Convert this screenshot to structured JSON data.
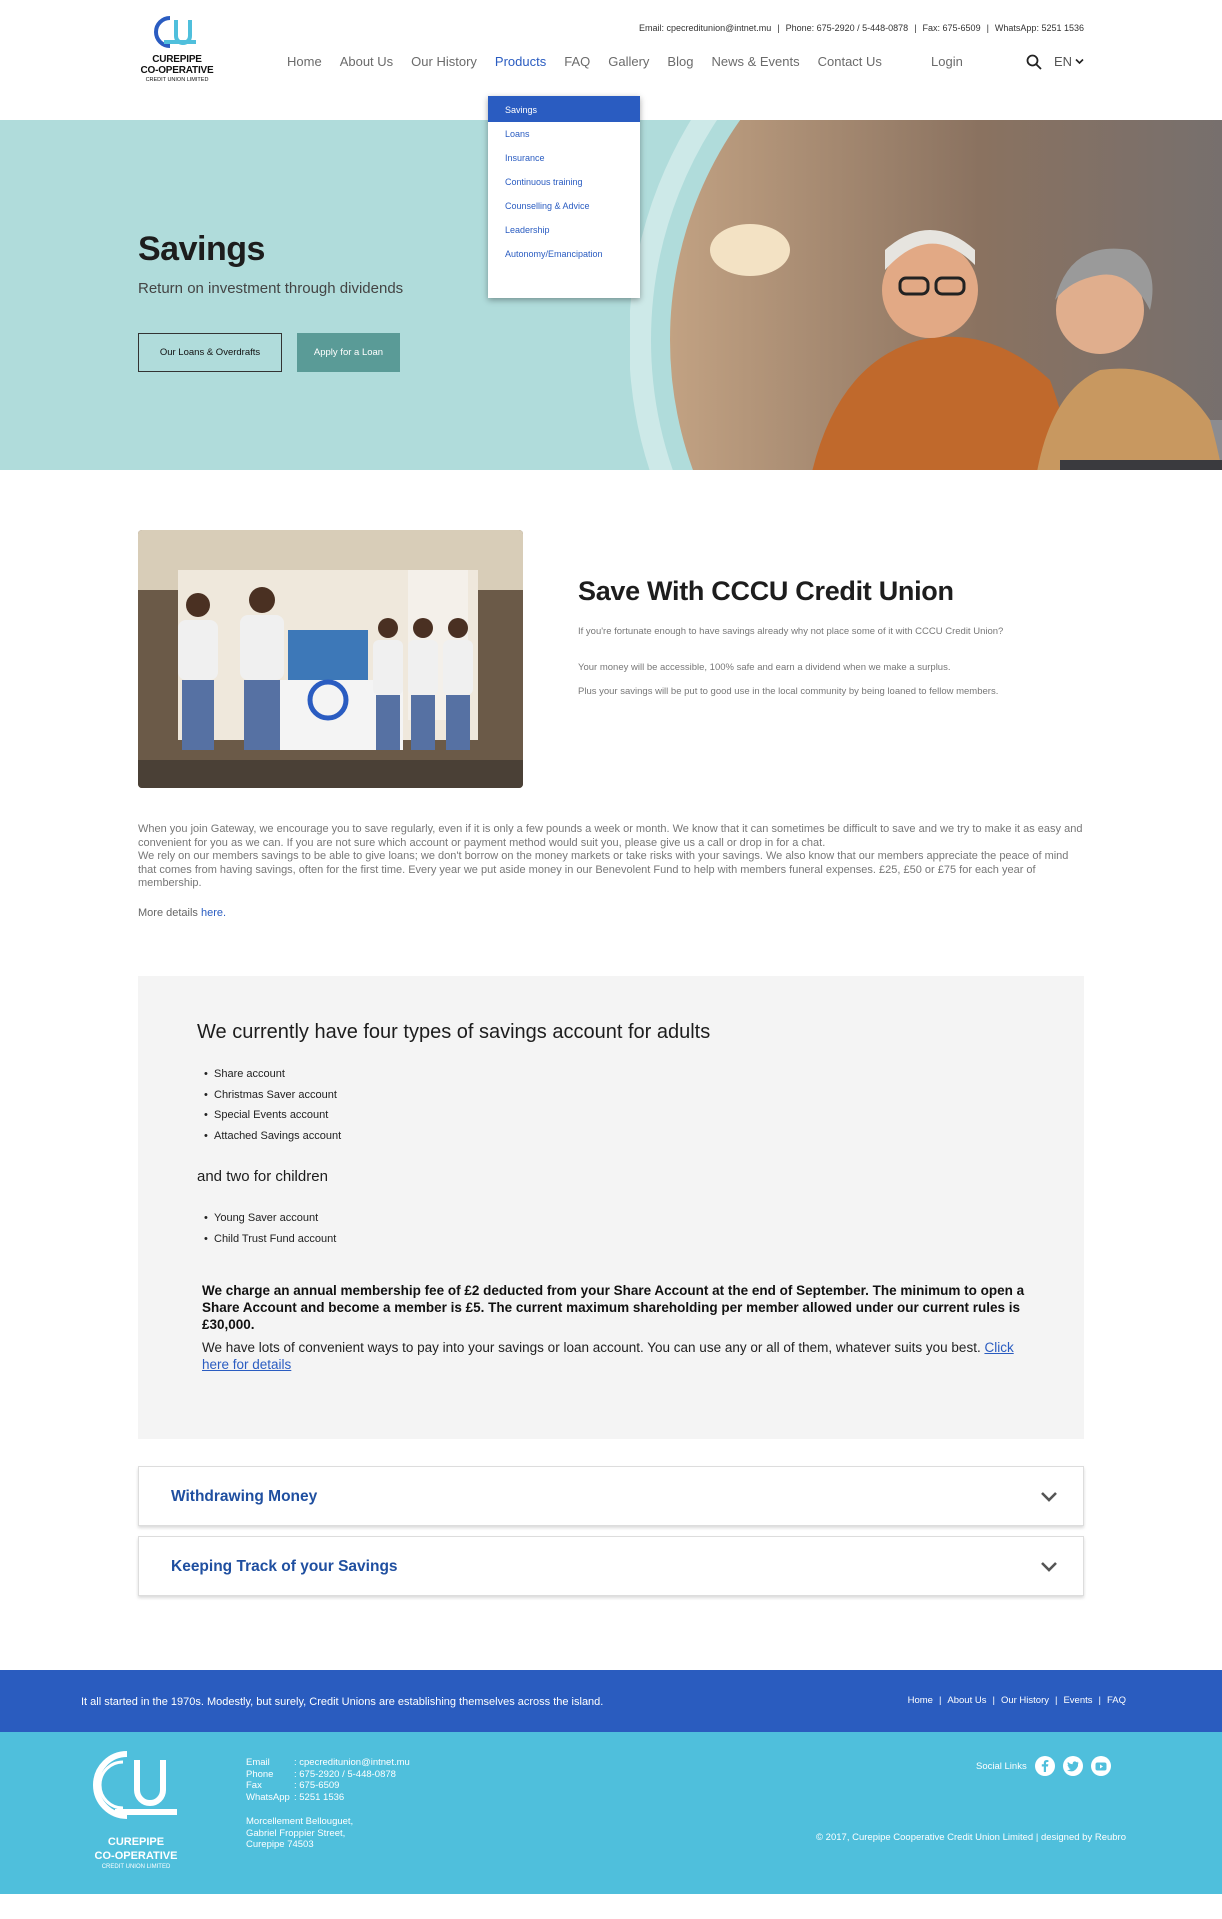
{
  "header": {
    "logo": {
      "line1": "CUREPIPE",
      "line2": "CO-OPERATIVE",
      "line3": "CREDIT UNION LIMITED"
    },
    "top_info": {
      "email": "Email: cpecreditunion@intnet.mu",
      "phone": "Phone: 675-2920 / 5-448-0878",
      "fax": "Fax: 675-6509",
      "whatsapp": "WhatsApp: 5251 1536"
    },
    "nav": [
      "Home",
      "About Us",
      "Our History",
      "Products",
      "FAQ",
      "Gallery",
      "Blog",
      "News & Events",
      "Contact Us"
    ],
    "login": "Login",
    "lang": "EN"
  },
  "dropdown": {
    "items": [
      "Savings",
      "Loans",
      "Insurance",
      "Continuous training",
      "Counselling & Advice",
      "Leadership",
      "Autonomy/Emancipation"
    ]
  },
  "hero": {
    "title": "Savings",
    "subtitle": "Return on investment through dividends",
    "btn_outline": "Our Loans & Overdrafts",
    "btn_fill": "Apply for a Loan"
  },
  "intro": {
    "title": "Save With CCCU Credit Union",
    "p1": "If you're fortunate enough to have savings already why not place some of it with CCCU Credit Union?",
    "p2": "Your money will be accessible, 100% safe and earn a dividend when we make a surplus.",
    "p3": "Plus your savings will be put to good use in the local community by being loaned to fellow members."
  },
  "body": {
    "p1": "When you join Gateway, we encourage you to save regularly, even if it is only a few pounds a week or month. We know that it can sometimes be difficult to save and we try to make it as easy and convenient for you as we can. If you are not sure which account or payment method would suit you, please give us a call or drop in for a chat.",
    "p2": "We rely on our members savings to be able to give loans; we don't borrow on the money markets or take risks with your savings. We also know that our members appreciate the peace of mind that comes from having savings, often for the first time. Every year we put aside money in our Benevolent Fund to help with members funeral expenses. £25, £50 or £75 for each year of membership.",
    "more_prefix": "More details ",
    "more_link": "here."
  },
  "panel": {
    "title": "We currently have four types of savings account for adults",
    "adult_accounts": [
      "Share account",
      "Christmas Saver account",
      "Special Events account",
      "Attached Savings account"
    ],
    "children_title": "and two for children",
    "child_accounts": [
      "Young Saver account",
      "Child Trust Fund account"
    ],
    "fee": "We charge an annual membership fee of £2 deducted from your Share Account at the end of September. The minimum to open a Share Account and become a member is £5. The current maximum shareholding per member allowed under our current rules is £30,000.",
    "ways": "We have lots of convenient ways to pay into your savings or loan account. You can use any or all of them, whatever suits you best. ",
    "ways_link": "Click here for details"
  },
  "accordions": [
    "Withdrawing Money",
    "Keeping Track of your Savings"
  ],
  "footer": {
    "tagline": "It all started in the 1970s. Modestly, but surely, Credit Unions are establishing themselves across the island.",
    "links": [
      "Home",
      "About Us",
      "Our History",
      "Events",
      "FAQ"
    ],
    "contact": [
      {
        "k": "Email",
        "v": ": cpecreditunion@intnet.mu"
      },
      {
        "k": "Phone",
        "v": ": 675-2920 / 5-448-0878"
      },
      {
        "k": "Fax",
        "v": ": 675-6509"
      },
      {
        "k": "WhatsApp",
        "v": ": 5251 1536"
      }
    ],
    "address": [
      "Morcellement Bellouguet,",
      "Gabriel Froppier Street,",
      "Curepipe 74503"
    ],
    "social_label": "Social Links",
    "copyright": "© 2017, Curepipe Cooperative Credit Union Limited | designed by Reubro",
    "logo": {
      "line1": "CUREPIPE",
      "line2": "CO-OPERATIVE",
      "line3": "CREDIT UNION LIMITED"
    }
  },
  "colors": {
    "accent": "#2a5cc1",
    "hero_bg": "#b0dcdb",
    "button_teal": "#5a9b97",
    "footer_dark": "#2a5cbf",
    "footer_light": "#4fbfdc"
  }
}
